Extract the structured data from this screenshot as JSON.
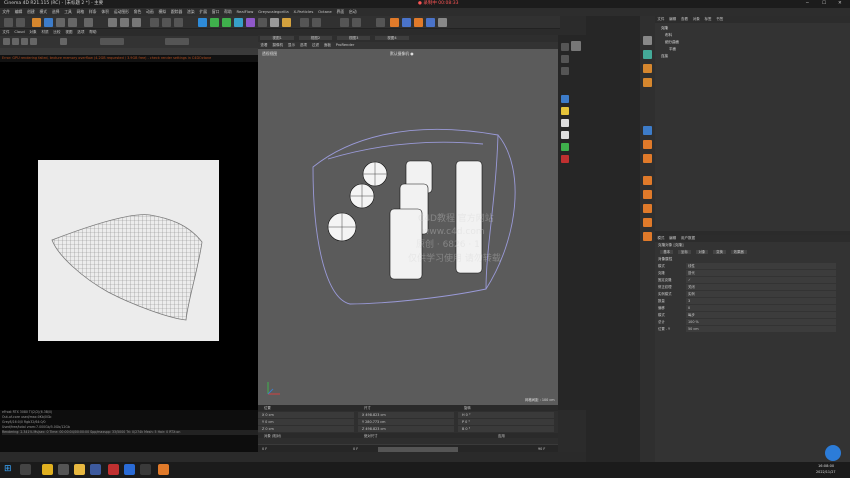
{
  "window_title": "Cinema 4D R21.115 (RC) - [未标题 2 *] - 主要",
  "rec_label": "● 录制中 00:08:33",
  "menu": [
    "文件",
    "编辑",
    "创建",
    "模式",
    "选择",
    "工具",
    "网格",
    "样条",
    "体积",
    "运动图形",
    "角色",
    "动画",
    "模拟",
    "跟踪器",
    "渲染",
    "扩展",
    "窗口",
    "帮助",
    "RealFlow",
    "Greyscalegorilla",
    "X-Particles",
    "Octane",
    "界面",
    "启动"
  ],
  "render_view": {
    "menu": [
      "文件",
      "Cloud",
      "对象",
      "材质",
      "比较",
      "视图",
      "选项",
      "帮助"
    ],
    "status_text": "Error: GPU rendering failed, texture memory overflow (4.2GB requested / 3.9GB free) - check render settings in C4DOctane",
    "info_lines": [
      "eFrost RTX 3080 TI(2/2)(6.3B/0)",
      "Out-of-core used/max:0Kb/0Gb",
      "Grey8/16:0/0   Rgb32/64:0/0",
      "Used/free/total vram:7.000Gb/5.0Gb/12Gb"
    ],
    "rendering_line": "Rendering: 2.341%  Ms/sec: 0   Time: 00:00:04/00:00:00   Spp/maxspp: 33/5000   Tri: 0/274k   Mesh: 5   Hair: 0   RTX:on"
  },
  "viewport": {
    "tabs": [
      "视图1",
      "视图2",
      "视图3",
      "视图4"
    ],
    "menu": [
      "查看",
      "摄像机",
      "显示",
      "选项",
      "过滤",
      "面板",
      "ProRender"
    ],
    "view_name": "透视视图",
    "camera_name": "默认摄像机 ●",
    "grid_label": "网格间距 : 100 cm",
    "watermark": [
      "C4D教程 官方网站",
      "www.c4d.com",
      "原创 · 6826 · 1",
      "仅供学习使用 请勿转载"
    ]
  },
  "object_manager": {
    "tabs": [
      "文件",
      "编辑",
      "查看",
      "对象",
      "标签",
      "书签"
    ],
    "objects": [
      "克隆",
      "布料",
      "细分曲面",
      "平面",
      "连接"
    ]
  },
  "attributes": {
    "tabs": [
      "模式",
      "编辑",
      "用户数据"
    ],
    "title": "克隆对象 [克隆]",
    "subtabs": [
      "基本",
      "坐标",
      "对象",
      "变换",
      "效果器"
    ],
    "section": "对象属性",
    "rows": [
      {
        "label": "模式",
        "value": "线性"
      },
      {
        "label": "克隆",
        "value": "迭代"
      },
      {
        "label": "固定克隆",
        "value": "✓"
      },
      {
        "label": "修正纹理",
        "value": "关闭"
      },
      {
        "label": "实例模式",
        "value": "实例"
      },
      {
        "label": "数量",
        "value": "3"
      },
      {
        "label": "偏移",
        "value": "0"
      },
      {
        "label": "模式",
        "value": "每步"
      },
      {
        "label": "总计",
        "value": "100 %"
      },
      {
        "label": "位置 . Y",
        "value": "50 cm"
      }
    ]
  },
  "coords": {
    "headers": [
      "位置",
      "尺寸",
      "旋转"
    ],
    "rows": [
      [
        "X  0 cm",
        "X  498.823 cm",
        "H  0 °"
      ],
      [
        "Y  0 cm",
        "Y  280.773 cm",
        "P  0 °"
      ],
      [
        "Z  0 cm",
        "Z  498.823 cm",
        "B  0 °"
      ]
    ],
    "mode": "对象 (相对)",
    "size_mode": "绝对尺寸",
    "apply": "应用"
  },
  "timeline": {
    "start": "0 F",
    "end": "90 F",
    "current": "0 F"
  },
  "taskbar": {
    "time": "16:08:00",
    "date": "2022/11/27"
  }
}
